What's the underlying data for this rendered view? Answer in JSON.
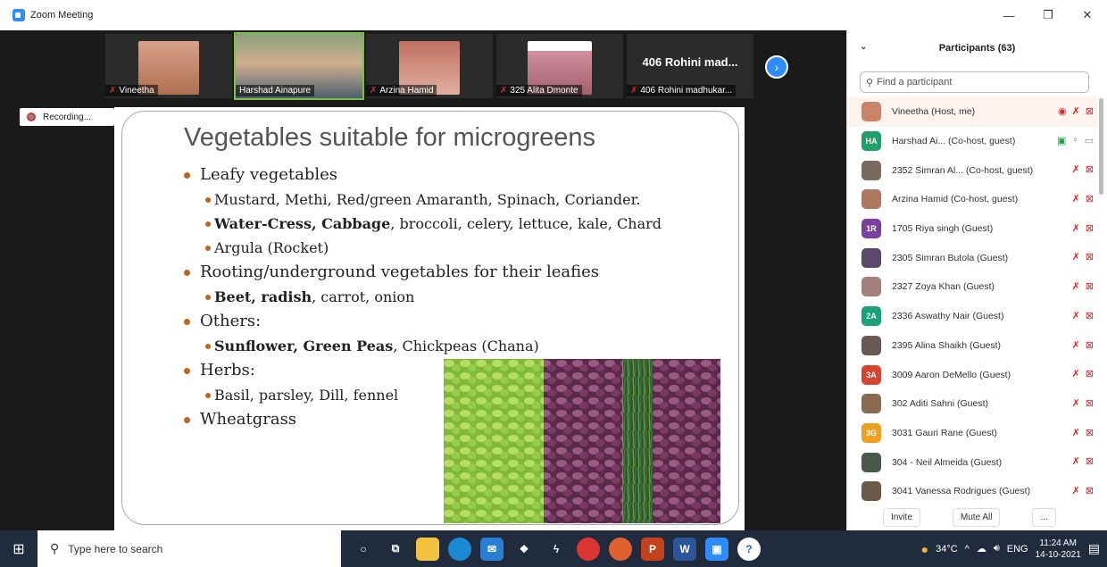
{
  "window": {
    "title": "Zoom Meeting",
    "controls": [
      "—",
      "❐",
      "✕"
    ]
  },
  "video_strip": {
    "tiles": [
      {
        "name": "Vineetha",
        "muted": true
      },
      {
        "name": "Harshad Ainapure",
        "muted": false
      },
      {
        "name": "Arzina Hamid",
        "muted": true
      },
      {
        "name": "325 Alita Dmonte",
        "muted": true
      },
      {
        "name": "406 Rohini madhukar...",
        "muted": true,
        "big_label": "406 Rohini mad..."
      }
    ],
    "next_icon": "chevron-right-icon"
  },
  "recording_label": "Recording...",
  "slide": {
    "title": "Vegetables suitable for microgreens",
    "bullets": [
      {
        "level": 1,
        "text": "Leafy vegetables"
      },
      {
        "level": 2,
        "text": "Mustard, Methi, Red/green Amaranth, Spinach, Coriander."
      },
      {
        "level": 2,
        "bold": "Water-Cress, Cabbage",
        "text": ", broccoli, celery,  lettuce, kale, Chard"
      },
      {
        "level": 2,
        "text": "Argula (Rocket)"
      },
      {
        "level": 1,
        "text": "Rooting/underground vegetables for their leafies"
      },
      {
        "level": 2,
        "bold": "Beet, radish",
        "text": ", carrot, onion"
      },
      {
        "level": 1,
        "text": "Others:"
      },
      {
        "level": 2,
        "bold": "Sunflower, Green Peas",
        "text": ", Chickpeas (Chana)"
      },
      {
        "level": 1,
        "text": "Herbs:"
      },
      {
        "level": 2,
        "text": "Basil, parsley, Dill, fennel"
      },
      {
        "level": 1,
        "text": "Wheatgrass"
      }
    ]
  },
  "participants": {
    "header": "Participants (63)",
    "search_placeholder": "Find a participant",
    "list": [
      {
        "name": "Vineetha (Host, me)",
        "avatar": "",
        "avatar_color": "#c9856a"
      },
      {
        "name": "Harshad Ai... (Co-host, guest)",
        "avatar": "HA",
        "avatar_color": "#22a06b"
      },
      {
        "name": "2352 Simran Al... (Co-host, guest)",
        "avatar": "",
        "avatar_color": "#7a6a5e"
      },
      {
        "name": "Arzina Hamid (Co-host, guest)",
        "avatar": "",
        "avatar_color": "#b07860"
      },
      {
        "name": "1705 Riya singh (Guest)",
        "avatar": "1R",
        "avatar_color": "#7b3fa0"
      },
      {
        "name": "2305 Simran Butola (Guest)",
        "avatar": "",
        "avatar_color": "#5a4a6a"
      },
      {
        "name": "2327 Zoya Khan (Guest)",
        "avatar": "",
        "avatar_color": "#a5807a"
      },
      {
        "name": "2336 Aswathy Nair (Guest)",
        "avatar": "2A",
        "avatar_color": "#1aa37a"
      },
      {
        "name": "2395 Alina Shaikh (Guest)",
        "avatar": "",
        "avatar_color": "#6a5a55"
      },
      {
        "name": "3009 Aaron DeMello (Guest)",
        "avatar": "3A",
        "avatar_color": "#d6452f"
      },
      {
        "name": "302 Aditi Sahni (Guest)",
        "avatar": "",
        "avatar_color": "#8a6a50"
      },
      {
        "name": "3031 Gauri Rane (Guest)",
        "avatar": "3G",
        "avatar_color": "#f0a020"
      },
      {
        "name": "304 - Neil Almeida (Guest)",
        "avatar": "",
        "avatar_color": "#4a5a4a"
      },
      {
        "name": "3041 Vanessa Rodrigues (Guest)",
        "avatar": "",
        "avatar_color": "#6a5a4a"
      }
    ],
    "footer": {
      "invite": "Invite",
      "mute_all": "Mute All",
      "more": "..."
    }
  },
  "taskbar": {
    "search_placeholder": "Type here to search",
    "weather": "34°C",
    "language": "ENG",
    "time": "11:24 AM",
    "date": "14-10-2021"
  }
}
